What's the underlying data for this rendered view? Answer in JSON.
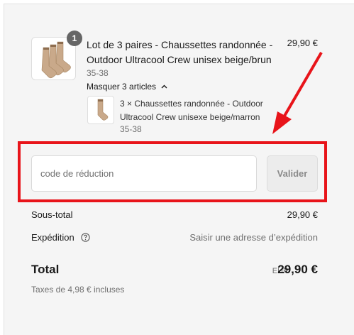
{
  "order_summary": {
    "product": {
      "quantity_badge": "1",
      "title_line1": "Lot de 3 paires - Chaussettes randonnée -",
      "title_line2": "Outdoor Ultracool Crew unisex beige/brun",
      "price": "29,90 €",
      "variant": "35-38",
      "toggle_label": "Masquer 3 articles",
      "bundle_item": {
        "title_line1": "3 × Chaussettes randonnée - Outdoor",
        "title_line2": "Ultracool Crew unisexe beige/marron",
        "variant": "35-38"
      }
    },
    "discount": {
      "placeholder": "code de réduction",
      "value": "",
      "apply_label": "Valider"
    },
    "subtotal": {
      "label": "Sous-total",
      "value": "29,90 €"
    },
    "shipping": {
      "label": "Expédition",
      "value": "Saisir une adresse d’expédition"
    },
    "total": {
      "label": "Total",
      "currency": "EUR",
      "value": "29,90 €",
      "taxes_note": "Taxes de 4,98 € incluses"
    }
  },
  "icons": {
    "sock_bundle": "socks-image",
    "sock_single": "sock-image",
    "collapse": "chevron-up-icon",
    "help": "help-circle-icon"
  },
  "colors": {
    "panel_background": "#f5f5f5",
    "highlight_annotation": "#e8141a",
    "badge": "#666666",
    "disabled_button": "#ececec"
  }
}
